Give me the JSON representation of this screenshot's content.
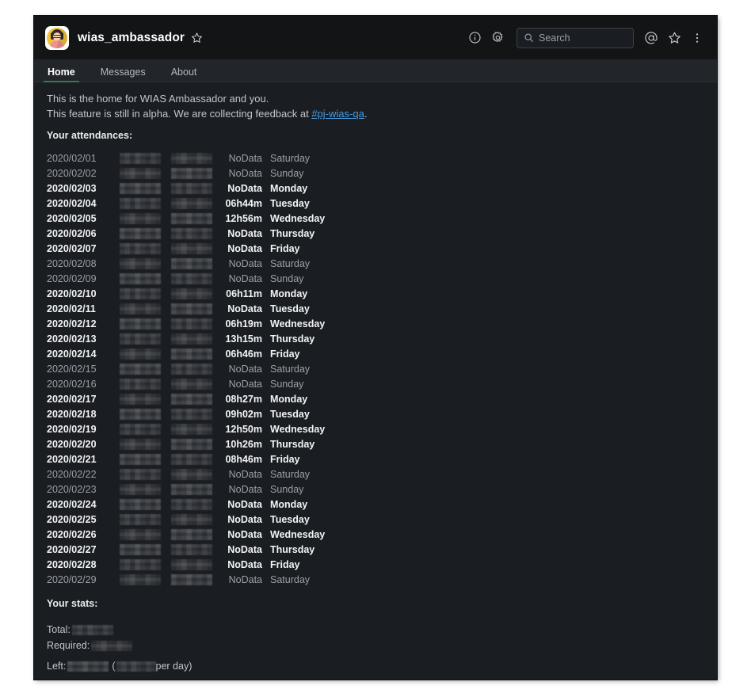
{
  "window": {
    "background": "#1a1d21",
    "topbar_background": "#121416",
    "accent_green": "#2f7a5a",
    "link_blue": "#4a9ae0"
  },
  "topbar": {
    "avatar_name": "workspace-avatar",
    "workspace_title": "wias_ambassador",
    "star_icon": "star-outline-icon",
    "info_icon": "info-circle-icon",
    "settings_icon": "gear-icon",
    "mentions_icon": "at-mention-icon",
    "saved_icon": "star-outline-icon",
    "more_icon": "kebab-menu-icon"
  },
  "search": {
    "placeholder": "Search",
    "value": "",
    "icon": "search-icon"
  },
  "tabs": [
    {
      "label": "Home",
      "active": true
    },
    {
      "label": "Messages",
      "active": false
    },
    {
      "label": "About",
      "active": false
    }
  ],
  "intro": {
    "line1": "This is the home for WIAS Ambassador and you.",
    "line2_before": "This feature is still in alpha. We are collecting feedback at ",
    "line2_link": "#pj-wias-qa",
    "line2_after": "."
  },
  "attendances": {
    "heading": "Your attendances:",
    "columns": [
      "date",
      "clock_in",
      "clock_out",
      "duration",
      "weekday"
    ],
    "redacted_label": "redacted",
    "rows": [
      {
        "date": "2020/02/01",
        "duration": "NoData",
        "weekday": "Saturday",
        "weekend": true
      },
      {
        "date": "2020/02/02",
        "duration": "NoData",
        "weekday": "Sunday",
        "weekend": true
      },
      {
        "date": "2020/02/03",
        "duration": "NoData",
        "weekday": "Monday",
        "weekend": false
      },
      {
        "date": "2020/02/04",
        "duration": "06h44m",
        "weekday": "Tuesday",
        "weekend": false
      },
      {
        "date": "2020/02/05",
        "duration": "12h56m",
        "weekday": "Wednesday",
        "weekend": false
      },
      {
        "date": "2020/02/06",
        "duration": "NoData",
        "weekday": "Thursday",
        "weekend": false
      },
      {
        "date": "2020/02/07",
        "duration": "NoData",
        "weekday": "Friday",
        "weekend": false
      },
      {
        "date": "2020/02/08",
        "duration": "NoData",
        "weekday": "Saturday",
        "weekend": true
      },
      {
        "date": "2020/02/09",
        "duration": "NoData",
        "weekday": "Sunday",
        "weekend": true
      },
      {
        "date": "2020/02/10",
        "duration": "06h11m",
        "weekday": "Monday",
        "weekend": false
      },
      {
        "date": "2020/02/11",
        "duration": "NoData",
        "weekday": "Tuesday",
        "weekend": false
      },
      {
        "date": "2020/02/12",
        "duration": "06h19m",
        "weekday": "Wednesday",
        "weekend": false
      },
      {
        "date": "2020/02/13",
        "duration": "13h15m",
        "weekday": "Thursday",
        "weekend": false
      },
      {
        "date": "2020/02/14",
        "duration": "06h46m",
        "weekday": "Friday",
        "weekend": false
      },
      {
        "date": "2020/02/15",
        "duration": "NoData",
        "weekday": "Saturday",
        "weekend": true
      },
      {
        "date": "2020/02/16",
        "duration": "NoData",
        "weekday": "Sunday",
        "weekend": true
      },
      {
        "date": "2020/02/17",
        "duration": "08h27m",
        "weekday": "Monday",
        "weekend": false
      },
      {
        "date": "2020/02/18",
        "duration": "09h02m",
        "weekday": "Tuesday",
        "weekend": false
      },
      {
        "date": "2020/02/19",
        "duration": "12h50m",
        "weekday": "Wednesday",
        "weekend": false
      },
      {
        "date": "2020/02/20",
        "duration": "10h26m",
        "weekday": "Thursday",
        "weekend": false
      },
      {
        "date": "2020/02/21",
        "duration": "08h46m",
        "weekday": "Friday",
        "weekend": false
      },
      {
        "date": "2020/02/22",
        "duration": "NoData",
        "weekday": "Saturday",
        "weekend": true
      },
      {
        "date": "2020/02/23",
        "duration": "NoData",
        "weekday": "Sunday",
        "weekend": true
      },
      {
        "date": "2020/02/24",
        "duration": "NoData",
        "weekday": "Monday",
        "weekend": false
      },
      {
        "date": "2020/02/25",
        "duration": "NoData",
        "weekday": "Tuesday",
        "weekend": false
      },
      {
        "date": "2020/02/26",
        "duration": "NoData",
        "weekday": "Wednesday",
        "weekend": false
      },
      {
        "date": "2020/02/27",
        "duration": "NoData",
        "weekday": "Thursday",
        "weekend": false
      },
      {
        "date": "2020/02/28",
        "duration": "NoData",
        "weekday": "Friday",
        "weekend": false
      },
      {
        "date": "2020/02/29",
        "duration": "NoData",
        "weekday": "Saturday",
        "weekend": true
      }
    ]
  },
  "stats": {
    "heading": "Your stats:",
    "total_label": "Total:",
    "total_value": "",
    "required_label": "Required:",
    "required_value": "",
    "left_label": "Left:",
    "left_value": "",
    "per_day_value": "",
    "per_day_suffix": "per day)",
    "paren_open": "("
  }
}
